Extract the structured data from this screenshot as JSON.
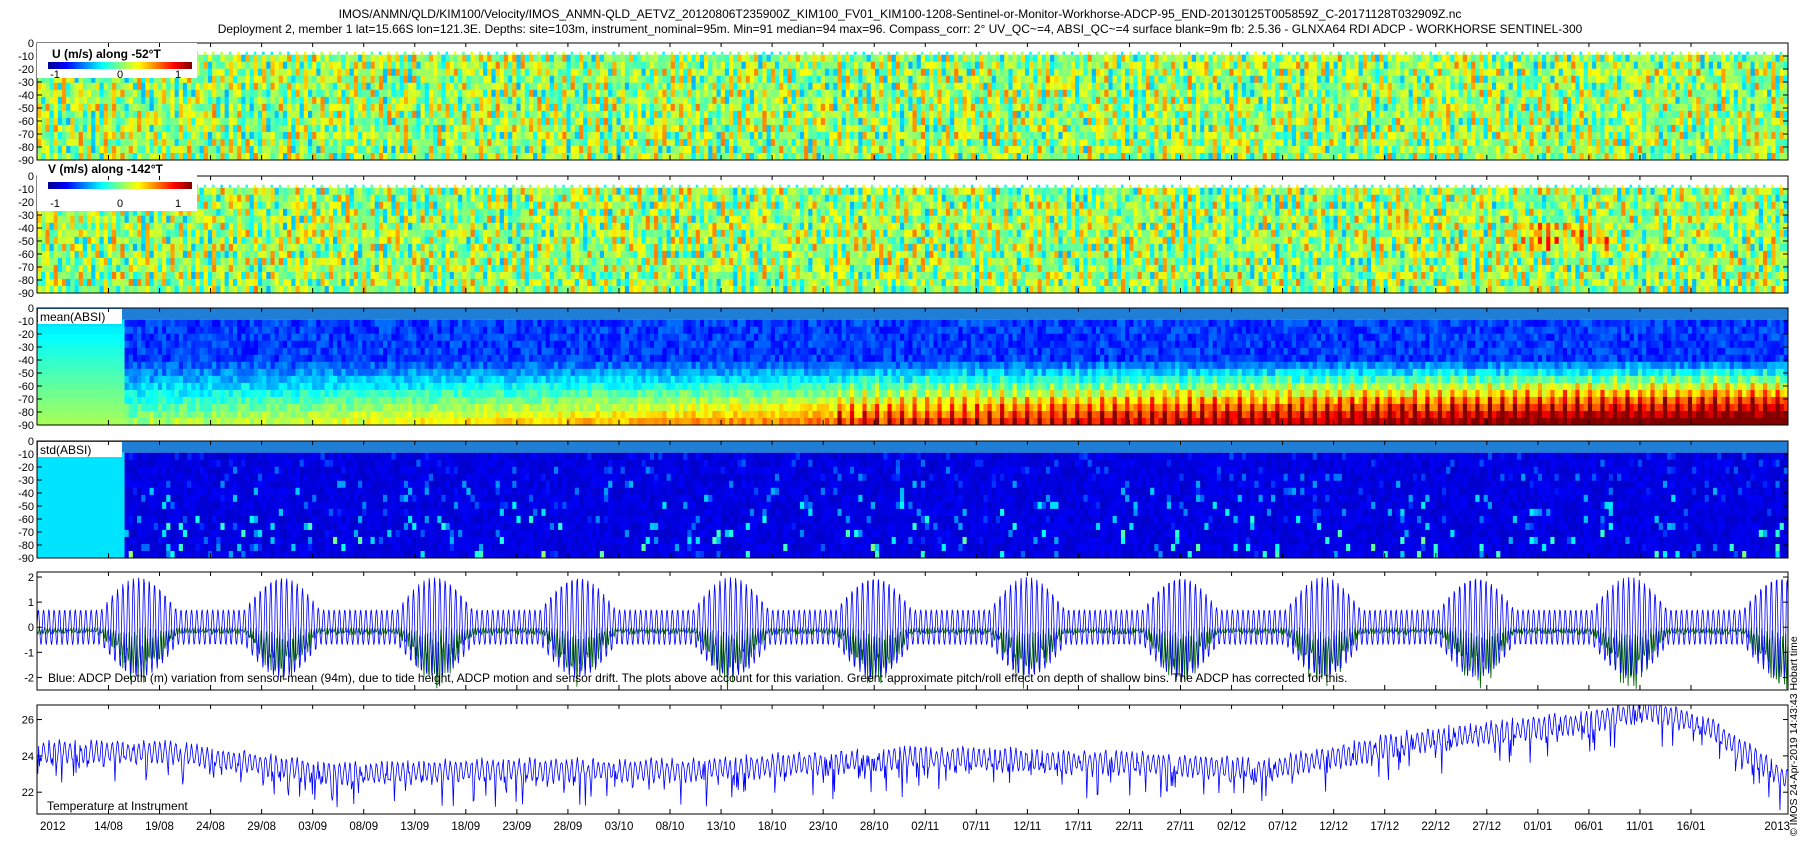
{
  "header": {
    "line1": "IMOS/ANMN/QLD/KIM100/Velocity/IMOS_ANMN-QLD_AETVZ_20120806T235900Z_KIM100_FV01_KIM100-1208-Sentinel-or-Monitor-Workhorse-ADCP-95_END-20130125T005859Z_C-20171128T032909Z.nc",
    "line2": "Deployment 2, member 1 lat=15.66S lon=121.3E. Depths: site=103m, instrument_nominal=95m. Min=91 median=94 max=96. Compass_corr: 2° UV_QC~=4, ABSI_QC~=4 surface blank=9m fb: 2.5.36 - GLNXA64 RDI ADCP - WORKHORSE SENTINEL-300"
  },
  "side_label": "© IMOS 24-Apr-2019 14:43:43 Hobart time",
  "colors": {
    "depth_line": "#0000ff",
    "pitch_roll_line": "#006400",
    "temperature_line": "#0000ff",
    "colormap": "jet"
  },
  "chart_data": [
    {
      "id": "u",
      "type": "heatmap",
      "label": "U (m/s) along -52°T",
      "ylim": [
        -90,
        0
      ],
      "yticks": [
        0,
        -10,
        -20,
        -30,
        -40,
        -50,
        -60,
        -70,
        -80,
        -90
      ],
      "colorbar": {
        "range": [
          -1,
          1
        ],
        "ticks": [
          "-1",
          "0",
          "1"
        ]
      },
      "typical_value": 0.05
    },
    {
      "id": "v",
      "type": "heatmap",
      "label": "V (m/s) along -142°T",
      "ylim": [
        -90,
        0
      ],
      "yticks": [
        0,
        -10,
        -20,
        -30,
        -40,
        -50,
        -60,
        -70,
        -80,
        -90
      ],
      "colorbar": {
        "range": [
          -1,
          1
        ],
        "ticks": [
          "-1",
          "0",
          "1"
        ]
      },
      "typical_value": 0.05
    },
    {
      "id": "mean_absi",
      "type": "heatmap",
      "label": "mean(ABSI)",
      "ylim": [
        -90,
        0
      ],
      "yticks": [
        0,
        -10,
        -20,
        -30,
        -40,
        -50,
        -60,
        -70,
        -80,
        -90
      ]
    },
    {
      "id": "std_absi",
      "type": "heatmap",
      "label": "std(ABSI)",
      "ylim": [
        -90,
        0
      ],
      "yticks": [
        0,
        -10,
        -20,
        -30,
        -40,
        -50,
        -60,
        -70,
        -80,
        -90
      ]
    },
    {
      "id": "depth_variation",
      "type": "line",
      "ylim": [
        -2.5,
        2.2
      ],
      "yticks": [
        2,
        1,
        0,
        -1,
        -2
      ],
      "note": "Blue: ADCP Depth (m) variation from sensor-mean (94m), due to tide height, ADCP motion and sensor drift. The plots above account for this variation. Green: approximate pitch/roll effect on depth of shallow bins. The ADCP has corrected for this.",
      "series": [],
      "tide_amplitude_m": 2.0,
      "spring_neap_peaks": [
        "17/08",
        "31/08",
        "15/09",
        "29/09",
        "14/10",
        "28/10",
        "12/11",
        "27/11",
        "11/12",
        "26/12",
        "10/01"
      ]
    },
    {
      "id": "temperature",
      "type": "line",
      "label": "Temperature at Instrument",
      "ylim": [
        20.8,
        26.8
      ],
      "yticks": [
        26,
        24,
        22
      ],
      "series": [],
      "trend": [
        {
          "x": "07/08",
          "y": 24.2
        },
        {
          "x": "20/08",
          "y": 24.2
        },
        {
          "x": "05/09",
          "y": 23.0
        },
        {
          "x": "20/09",
          "y": 23.2
        },
        {
          "x": "10/10",
          "y": 23.2
        },
        {
          "x": "01/11",
          "y": 23.9
        },
        {
          "x": "22/11",
          "y": 23.6
        },
        {
          "x": "05/12",
          "y": 23.2
        },
        {
          "x": "20/12",
          "y": 24.8
        },
        {
          "x": "05/01",
          "y": 25.8
        },
        {
          "x": "12/01",
          "y": 26.6
        },
        {
          "x": "18/01",
          "y": 25.5
        },
        {
          "x": "25/01",
          "y": 22.8
        }
      ]
    }
  ],
  "x_axis": {
    "year_start": "2012",
    "year_end": "2013",
    "date_ticks": [
      "14/08",
      "19/08",
      "24/08",
      "29/08",
      "03/09",
      "08/09",
      "13/09",
      "18/09",
      "23/09",
      "28/09",
      "03/10",
      "08/10",
      "13/10",
      "18/10",
      "23/10",
      "28/10",
      "02/11",
      "07/11",
      "12/11",
      "17/11",
      "22/11",
      "27/11",
      "02/12",
      "07/12",
      "12/12",
      "17/12",
      "22/12",
      "27/12",
      "01/01",
      "06/01",
      "11/01",
      "16/01"
    ]
  }
}
